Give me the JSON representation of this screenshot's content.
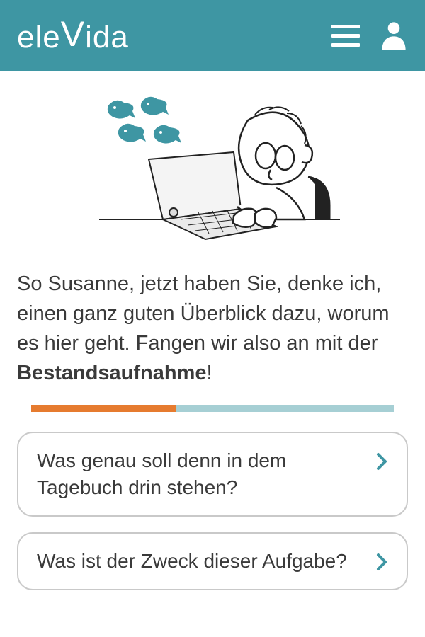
{
  "header": {
    "logo": "elevida"
  },
  "body": {
    "text_prefix": "So Susanne, jetzt haben Sie, denke ich, einen ganz guten Überblick dazu, worum es hier geht. Fangen wir also an mit der ",
    "text_bold": "Bestandsaufnahme",
    "text_suffix": "!"
  },
  "progress": {
    "percent": 40
  },
  "options": [
    {
      "label": "Was genau soll denn in dem Tagebuch drin stehen?"
    },
    {
      "label": "Was ist der Zweck dieser Aufgabe?"
    }
  ],
  "colors": {
    "primary": "#3e96a3",
    "accent": "#e67b2f",
    "progress_bg": "#a6cfd4"
  }
}
